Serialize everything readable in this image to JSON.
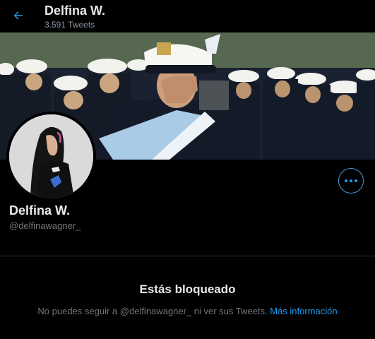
{
  "header": {
    "name": "Delfina W.",
    "tweet_count": "3.591 Tweets",
    "back_icon": "arrow-left-icon"
  },
  "profile": {
    "name": "Delfina W.",
    "handle": "@delfinawagner_",
    "more_icon": "more-horizontal-icon"
  },
  "blocked": {
    "title": "Estás bloqueado",
    "description": "No puedes seguir a @delfinawagner_ ni ver sus Tweets.",
    "link": "Más información"
  },
  "colors": {
    "background": "#000000",
    "accent": "#1d9bf0",
    "text_primary": "#e7e9ea",
    "text_secondary": "#71767b",
    "divider": "#2f3336"
  }
}
